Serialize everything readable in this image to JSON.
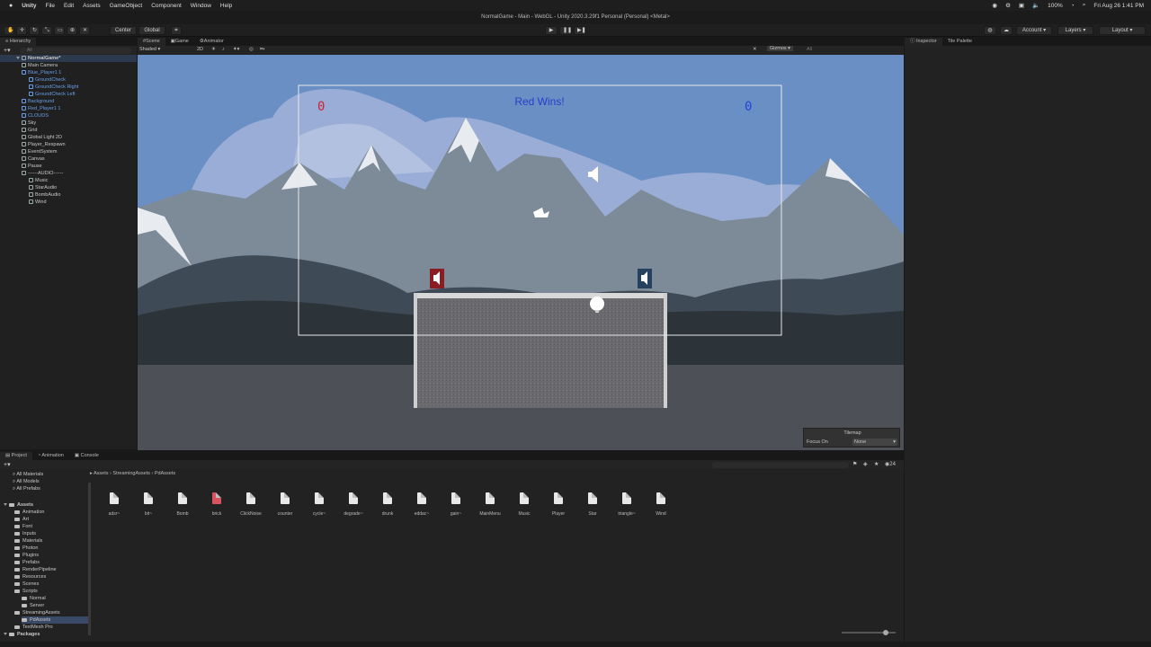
{
  "menubar": {
    "app": "Unity",
    "items": [
      "File",
      "Edit",
      "Assets",
      "GameObject",
      "Component",
      "Window",
      "Help"
    ],
    "battery": "100%",
    "clock": "Fri Aug 26  1:41 PM"
  },
  "window": {
    "title": "NormalGame - Main - WebGL - Unity 2020.3.29f1 Personal (Personal) <Metal>"
  },
  "toolbar": {
    "pivot": "Center",
    "space": "Global",
    "account": "Account",
    "layers": "Layers",
    "layout": "Layout"
  },
  "hierarchy": {
    "tab": "Hierarchy",
    "search_placeholder": "All",
    "scene": "NormalGame*",
    "items": [
      {
        "label": "Main Camera",
        "indent": 1,
        "blue": false
      },
      {
        "label": "Blue_Player1 1",
        "indent": 1,
        "blue": true
      },
      {
        "label": "GroundCheck",
        "indent": 2,
        "blue": true
      },
      {
        "label": "GroundCheck Right",
        "indent": 2,
        "blue": true
      },
      {
        "label": "GroundCheck Left",
        "indent": 2,
        "blue": true
      },
      {
        "label": "Background",
        "indent": 1,
        "blue": true
      },
      {
        "label": "Red_Player1 1",
        "indent": 1,
        "blue": true
      },
      {
        "label": "CLOUDS",
        "indent": 1,
        "blue": true
      },
      {
        "label": "Sky",
        "indent": 1,
        "blue": false
      },
      {
        "label": "Grid",
        "indent": 1,
        "blue": false
      },
      {
        "label": "Global Light 2D",
        "indent": 1,
        "blue": false
      },
      {
        "label": "Player_Respawn",
        "indent": 1,
        "blue": false
      },
      {
        "label": "EventSystem",
        "indent": 1,
        "blue": false
      },
      {
        "label": "Canvas",
        "indent": 1,
        "blue": false
      },
      {
        "label": "Pause",
        "indent": 1,
        "blue": false
      },
      {
        "label": "------AUDIO------",
        "indent": 1,
        "blue": false
      },
      {
        "label": "Music",
        "indent": 2,
        "blue": false
      },
      {
        "label": "StarAudio",
        "indent": 2,
        "blue": false
      },
      {
        "label": "BombAudio",
        "indent": 2,
        "blue": false
      },
      {
        "label": "Wind",
        "indent": 2,
        "blue": false
      }
    ]
  },
  "scene_view": {
    "tabs": [
      "Scene",
      "Game",
      "Animator"
    ],
    "shading": "Shaded",
    "gizmos": "Gizmos",
    "search_placeholder": "All",
    "win_text": "Red Wins!",
    "red_score": "0",
    "blue_score": "0",
    "red_color": "#cc2233",
    "blue_color": "#2244dd",
    "tilemap_title": "Tilemap",
    "focus_label": "Focus On",
    "focus_value": "None"
  },
  "inspector": {
    "tabs": [
      "Inspector",
      "Tile Palette"
    ]
  },
  "project": {
    "tabs": [
      "Project",
      "Animation",
      "Console"
    ],
    "favorites": [
      "All Materials",
      "All Models",
      "All Prefabs"
    ],
    "assets_root": "Assets",
    "folders": [
      {
        "label": "Animation",
        "indent": 1
      },
      {
        "label": "Art",
        "indent": 1
      },
      {
        "label": "Font",
        "indent": 1
      },
      {
        "label": "Inputs",
        "indent": 1
      },
      {
        "label": "Materials",
        "indent": 1
      },
      {
        "label": "Photon",
        "indent": 1
      },
      {
        "label": "Plugins",
        "indent": 1
      },
      {
        "label": "Prefabs",
        "indent": 1
      },
      {
        "label": "RenderPipeline",
        "indent": 1
      },
      {
        "label": "Resources",
        "indent": 1
      },
      {
        "label": "Scenes",
        "indent": 1
      },
      {
        "label": "Scripts",
        "indent": 1
      },
      {
        "label": "Normal",
        "indent": 2
      },
      {
        "label": "Server",
        "indent": 2
      },
      {
        "label": "StreamingAssets",
        "indent": 1
      },
      {
        "label": "PdAssets",
        "indent": 2
      },
      {
        "label": "TextMesh Pro",
        "indent": 1
      }
    ],
    "packages": "Packages",
    "breadcrumb": [
      "Assets",
      "StreamingAssets",
      "PdAssets"
    ],
    "item_count": "24",
    "files": [
      "adsr~",
      "bit~",
      "Bomb",
      "brick",
      "ClickNoise",
      "counter",
      "cycle~",
      "degrade~",
      "drunk",
      "eddac~",
      "gain~",
      "MainMenu",
      "Music",
      "Player",
      "Star",
      "triangle~",
      "Wind"
    ]
  }
}
